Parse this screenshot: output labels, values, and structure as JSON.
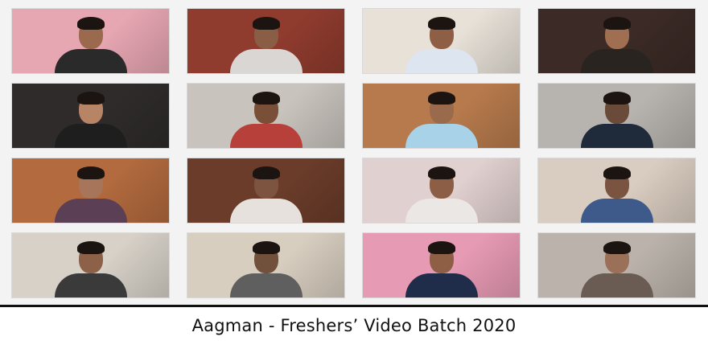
{
  "caption": "Aagman - Freshers’ Video Batch 2020",
  "participants": [
    {
      "bg": "#e6a6b2",
      "shirt": "#2a2a2a",
      "skin": "#9b6a4e"
    },
    {
      "bg": "#8f3b2e",
      "shirt": "#d9d6d4",
      "skin": "#8a5d45"
    },
    {
      "bg": "#e7e1d8",
      "shirt": "#dde5f0",
      "skin": "#8e5f45"
    },
    {
      "bg": "#3b2a26",
      "shirt": "#2a2420",
      "skin": "#a06f52"
    },
    {
      "bg": "#2e2b2a",
      "shirt": "#1e1e1e",
      "skin": "#b78566"
    },
    {
      "bg": "#c8c3bd",
      "shirt": "#b7413a",
      "skin": "#7a4f38"
    },
    {
      "bg": "#b77a4c",
      "shirt": "#a8d2e8",
      "skin": "#9a6a4c"
    },
    {
      "bg": "#b7b3ae",
      "shirt": "#1f2a3a",
      "skin": "#6a4a38"
    },
    {
      "bg": "#b26a3e",
      "shirt": "#5a3f55",
      "skin": "#a7765a"
    },
    {
      "bg": "#6b3c2a",
      "shirt": "#e7e1dd",
      "skin": "#7c5440"
    },
    {
      "bg": "#e0d0cf",
      "shirt": "#ebe7e5",
      "skin": "#8b5e45"
    },
    {
      "bg": "#d9ccc0",
      "shirt": "#3e5a8a",
      "skin": "#7a5440"
    },
    {
      "bg": "#d7d1c8",
      "shirt": "#3a3a3a",
      "skin": "#8d6048"
    },
    {
      "bg": "#d8cec0",
      "shirt": "#5f5f5f",
      "skin": "#71503c"
    },
    {
      "bg": "#e79ab4",
      "shirt": "#1f2d4a",
      "skin": "#8e5f45"
    },
    {
      "bg": "#bbb3ab",
      "shirt": "#6a5c52",
      "skin": "#9b7058"
    }
  ]
}
